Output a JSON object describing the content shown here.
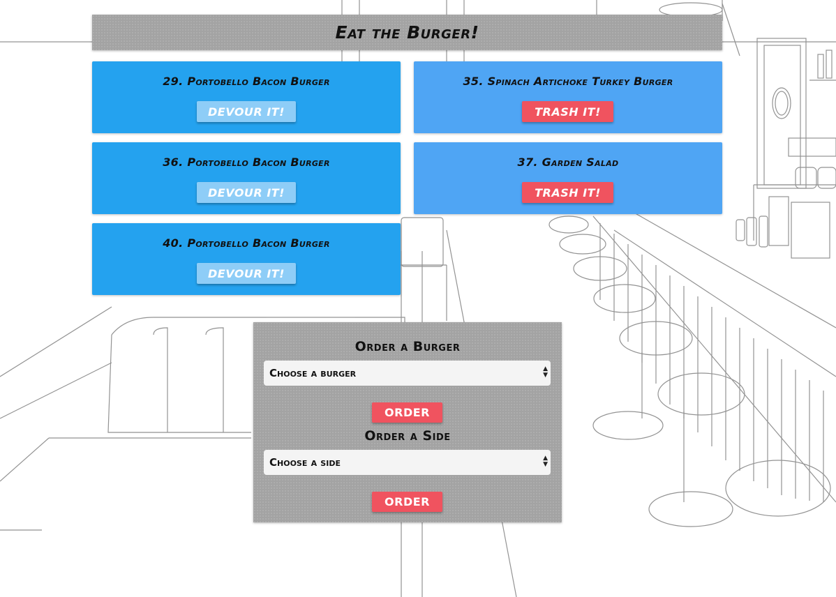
{
  "header": {
    "title": "Eat the Burger!"
  },
  "burgers_uneaten": [
    {
      "label": "29. Portobello Bacon Burger",
      "button": "DEVOUR IT!"
    },
    {
      "label": "36. Portobello Bacon Burger",
      "button": "DEVOUR IT!"
    },
    {
      "label": "40. Portobello Bacon Burger",
      "button": "DEVOUR IT!"
    }
  ],
  "burgers_devoured": [
    {
      "label": "35. Spinach Artichoke Turkey Burger",
      "button": "TRASH IT!"
    },
    {
      "label": "37. Garden Salad",
      "button": "TRASH IT!"
    }
  ],
  "order_burger": {
    "heading": "Order a Burger",
    "select_value": "Choose a burger",
    "button": "ORDER"
  },
  "order_side": {
    "heading": "Order a Side",
    "select_value": "Choose a side",
    "button": "ORDER"
  },
  "colors": {
    "uneaten_card": "#24a2ef",
    "devoured_card": "#4fa5f4",
    "devour_button": "#8ecdf7",
    "trash_button": "#f0535f",
    "panel_gray": "#a3a3a3"
  }
}
